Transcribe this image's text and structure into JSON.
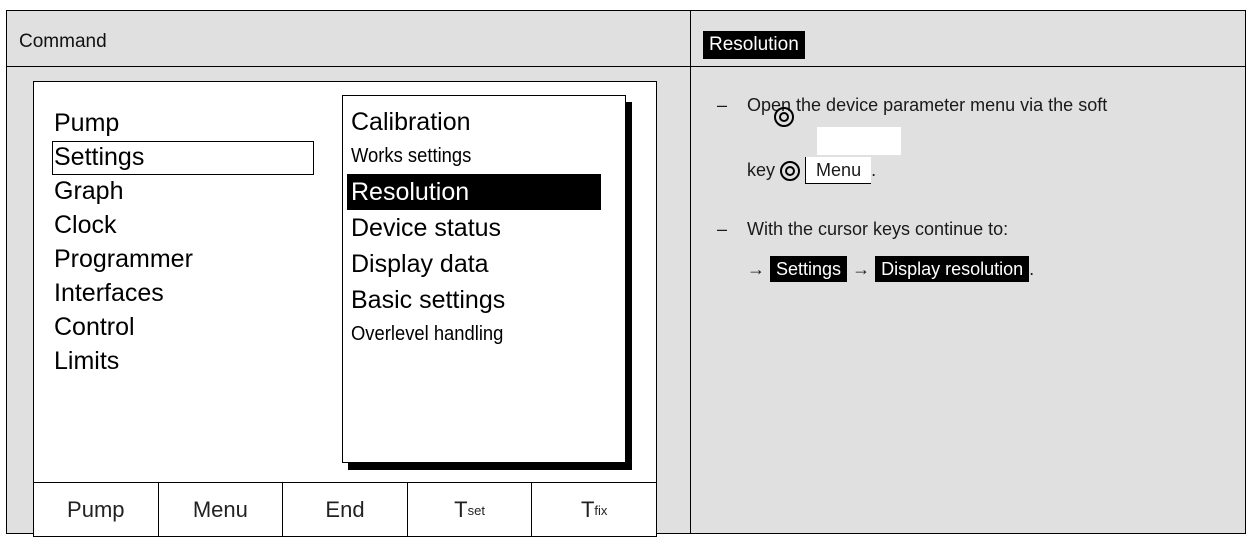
{
  "header": {
    "left_title": "Command",
    "right_title": "Resolution"
  },
  "screen": {
    "main_menu": [
      "Pump",
      "Settings",
      "Graph",
      "Clock",
      "Programmer",
      "Interfaces",
      "Control",
      "Limits"
    ],
    "main_menu_selected": "Settings",
    "submenu": [
      "Calibration",
      "Works settings",
      "Resolution",
      "Device status",
      "Display data",
      "Basic settings",
      "Overlevel handling"
    ],
    "submenu_selected": "Resolution",
    "softkeys": [
      {
        "label": "Pump",
        "sub": ""
      },
      {
        "label": "Menu",
        "sub": ""
      },
      {
        "label": "End",
        "sub": ""
      },
      {
        "label": "T",
        "sub": "set"
      },
      {
        "label": "T",
        "sub": "fix"
      }
    ]
  },
  "instructions": {
    "bullet": "–",
    "step1_text": "Open the device parameter menu via the soft",
    "step1_key_prefix": "key",
    "step1_key_label": "Menu",
    "step1_end": ".",
    "step2_text": "With the cursor keys continue to:",
    "arrow": "→",
    "path_1": "Settings",
    "path_2": "Display resolution",
    "path_end": "."
  },
  "icons": {
    "knob": "rotary-knob-icon"
  }
}
